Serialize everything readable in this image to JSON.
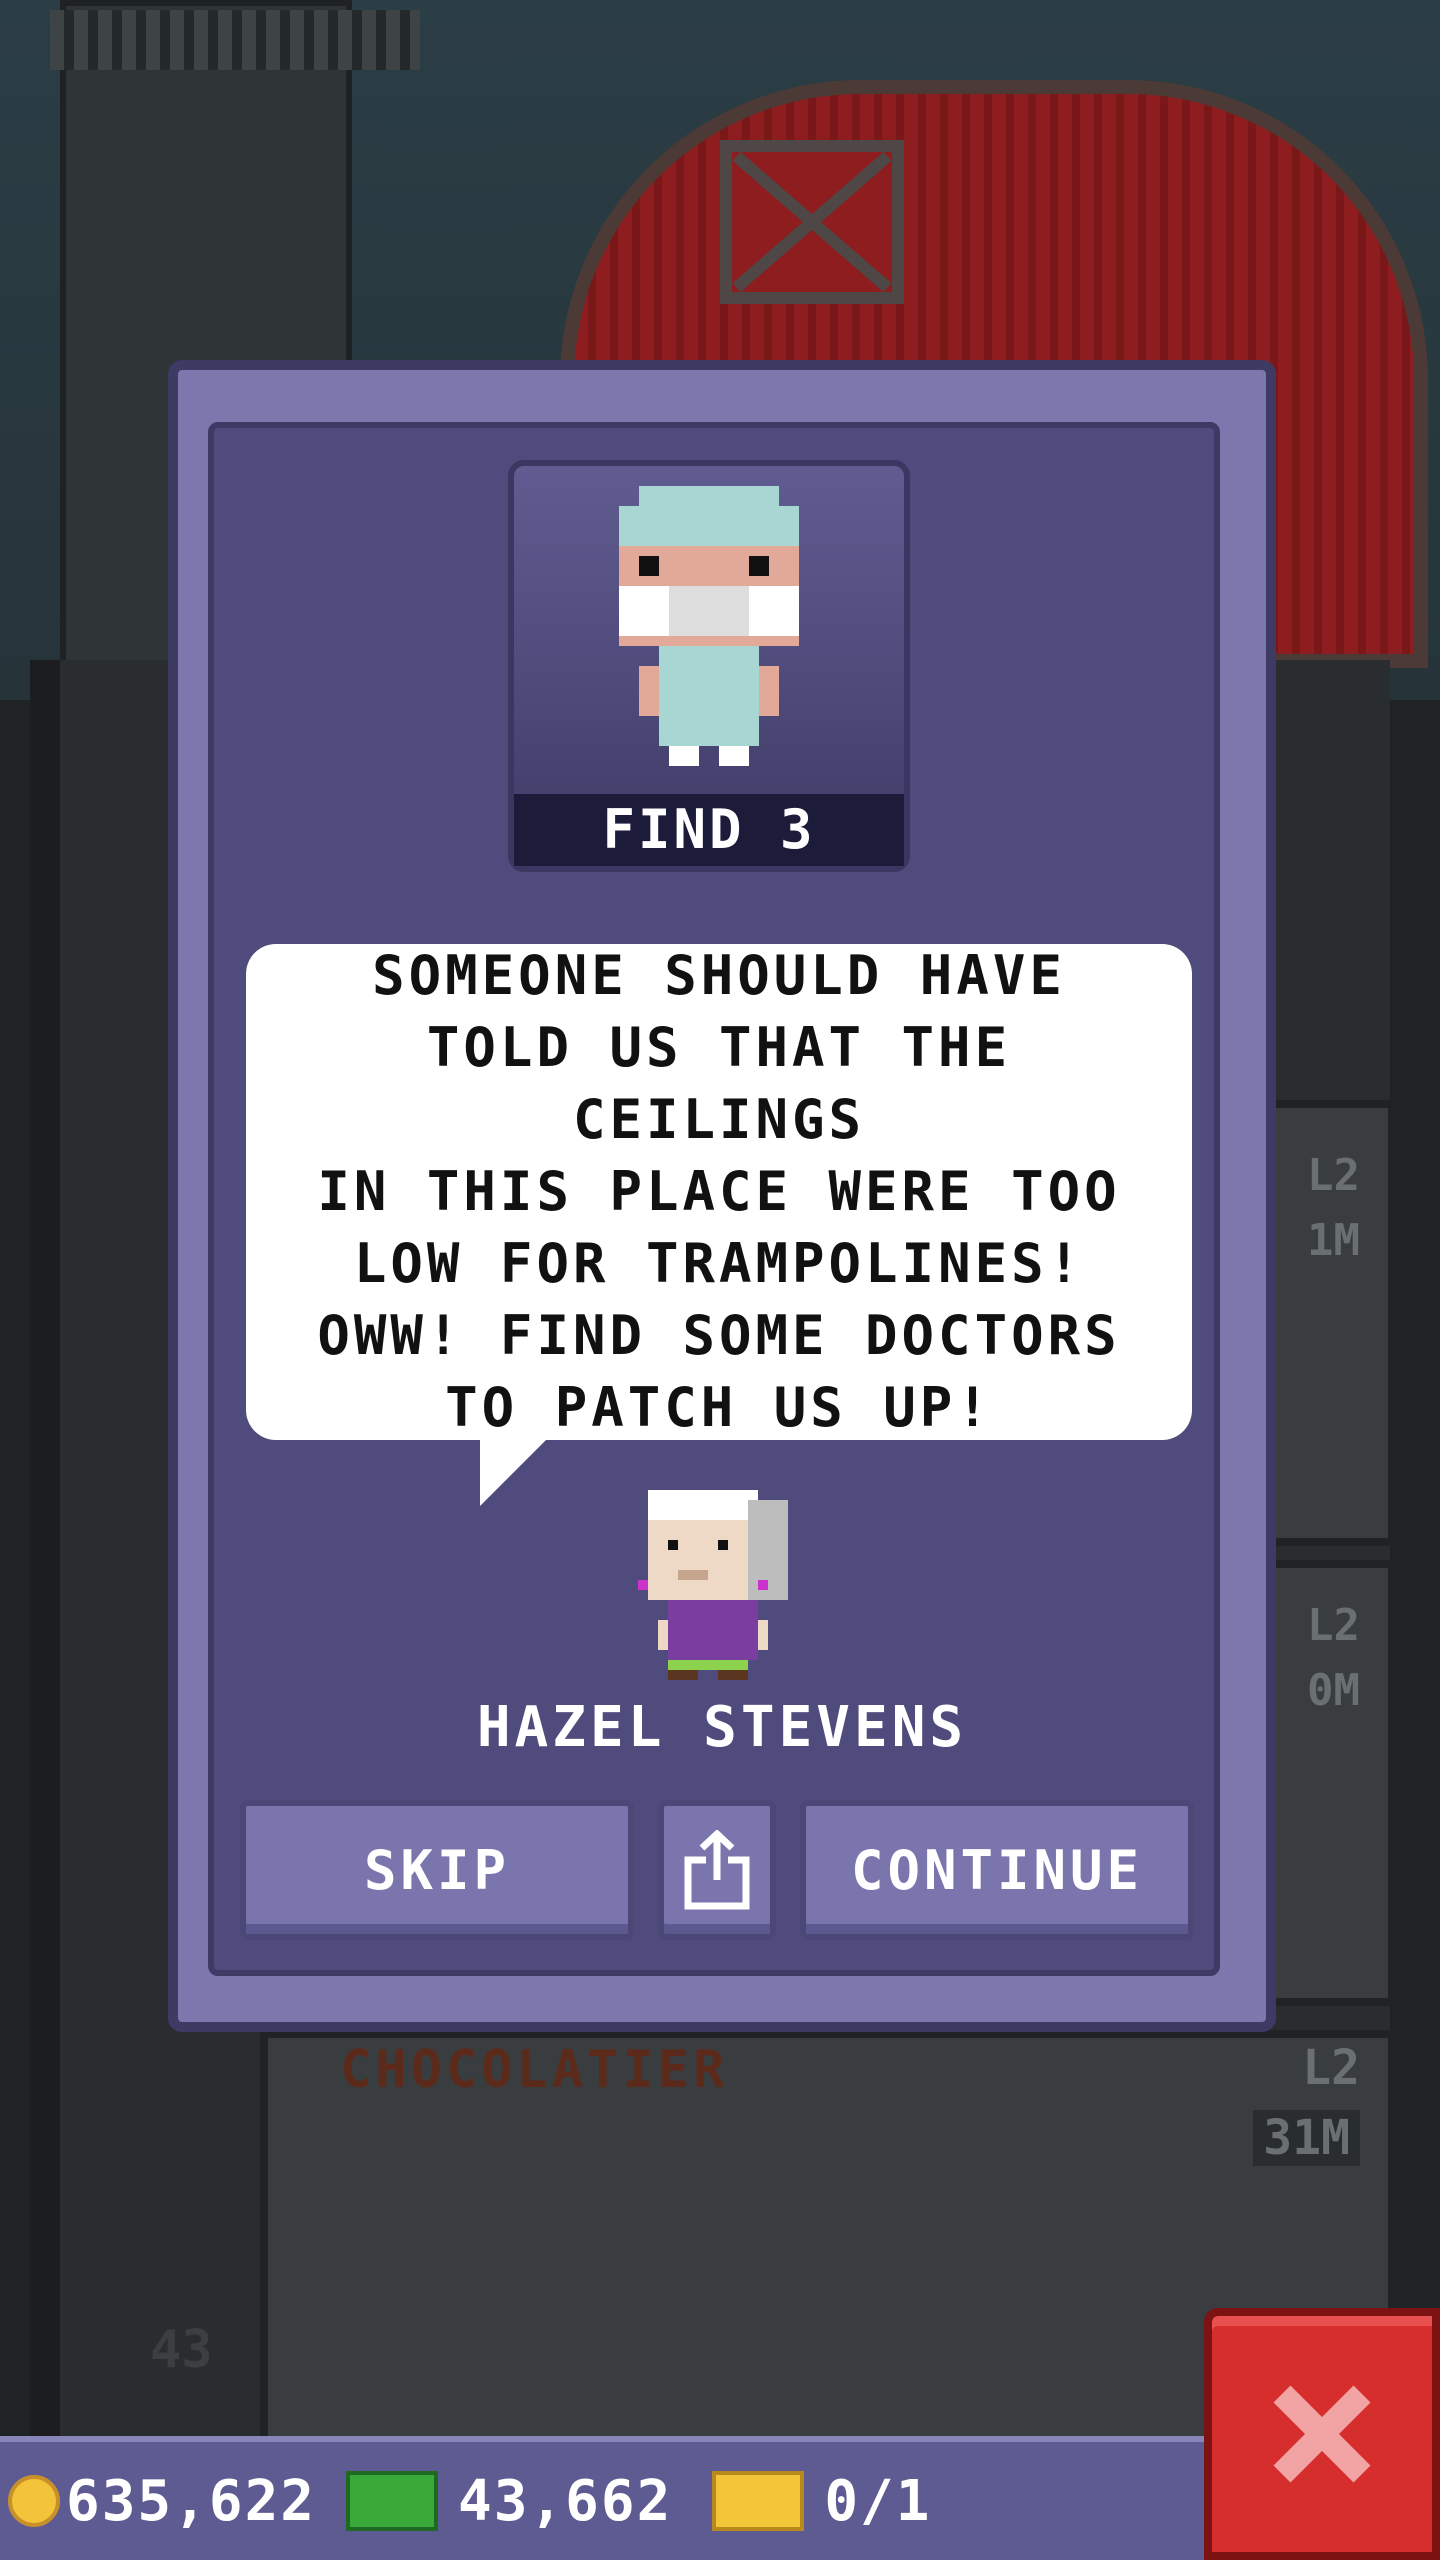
{
  "mission": {
    "find_label": "FIND 3",
    "message": "SOMEONE SHOULD HAVE\nTOLD US THAT THE CEILINGS\nIN THIS PLACE WERE TOO\nLOW FOR TRAMPOLINES!\nOWW! FIND SOME DOCTORS\nTO PATCH US UP!",
    "npc_name": "HAZEL STEVENS"
  },
  "buttons": {
    "skip": "SKIP",
    "continue": "CONTINUE"
  },
  "background": {
    "floor_labels": [
      "L2",
      "1M",
      "L2",
      "0M"
    ],
    "shop_name": "CHOCOLATIER",
    "shop_level": "L2",
    "shop_value": "31M",
    "floor_number": "43"
  },
  "status_bar": {
    "coins": "635,622",
    "bux": "43,662",
    "tickets": "0/1"
  },
  "colors": {
    "modal": "#7c77ad",
    "panel": "#4f4b7c",
    "close": "#d62d2d"
  }
}
